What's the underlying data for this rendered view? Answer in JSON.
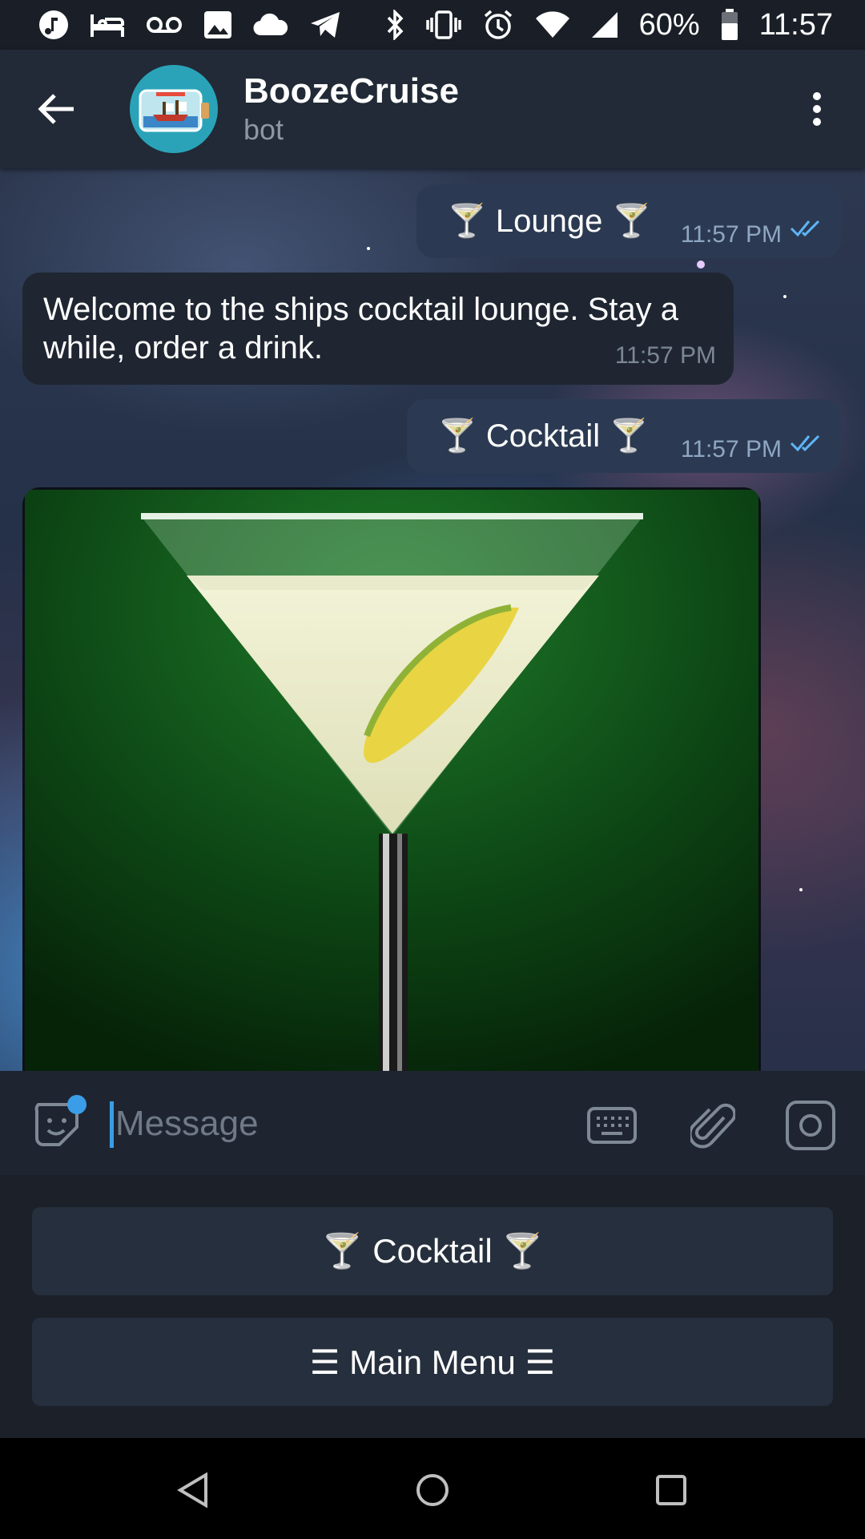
{
  "status_bar": {
    "battery": "60%",
    "time": "11:57",
    "left_icons": [
      "music-note-icon",
      "bed-icon",
      "voicemail-icon",
      "image-icon",
      "cloud-icon",
      "telegram-icon"
    ],
    "right_icons": [
      "bluetooth-icon",
      "vibrate-icon",
      "alarm-icon",
      "wifi-icon",
      "signal-icon",
      "battery-icon"
    ]
  },
  "header": {
    "title": "BoozeCruise",
    "subtitle": "bot"
  },
  "messages": [
    {
      "direction": "out",
      "text": "🍸 Lounge 🍸",
      "time": "11:57 PM",
      "read": true
    },
    {
      "direction": "in",
      "text": "Welcome to the ships cocktail lounge. Stay a while, order a drink.",
      "time": "11:57 PM"
    },
    {
      "direction": "out",
      "text": "🍸 Cocktail 🍸",
      "time": "11:57 PM",
      "read": true
    },
    {
      "direction": "in",
      "type": "photo",
      "subject": "cocktail glass with lime"
    }
  ],
  "input": {
    "placeholder": "Message"
  },
  "keyboard": {
    "buttons": [
      "🍸 Cocktail 🍸",
      "☰ Main Menu ☰"
    ]
  },
  "colors": {
    "header_bg": "#212a36",
    "outgoing_bubble": "#2b3a52",
    "incoming_bubble": "#1f2631",
    "accent": "#3b9de8",
    "keyboard_button": "#262f3d"
  }
}
